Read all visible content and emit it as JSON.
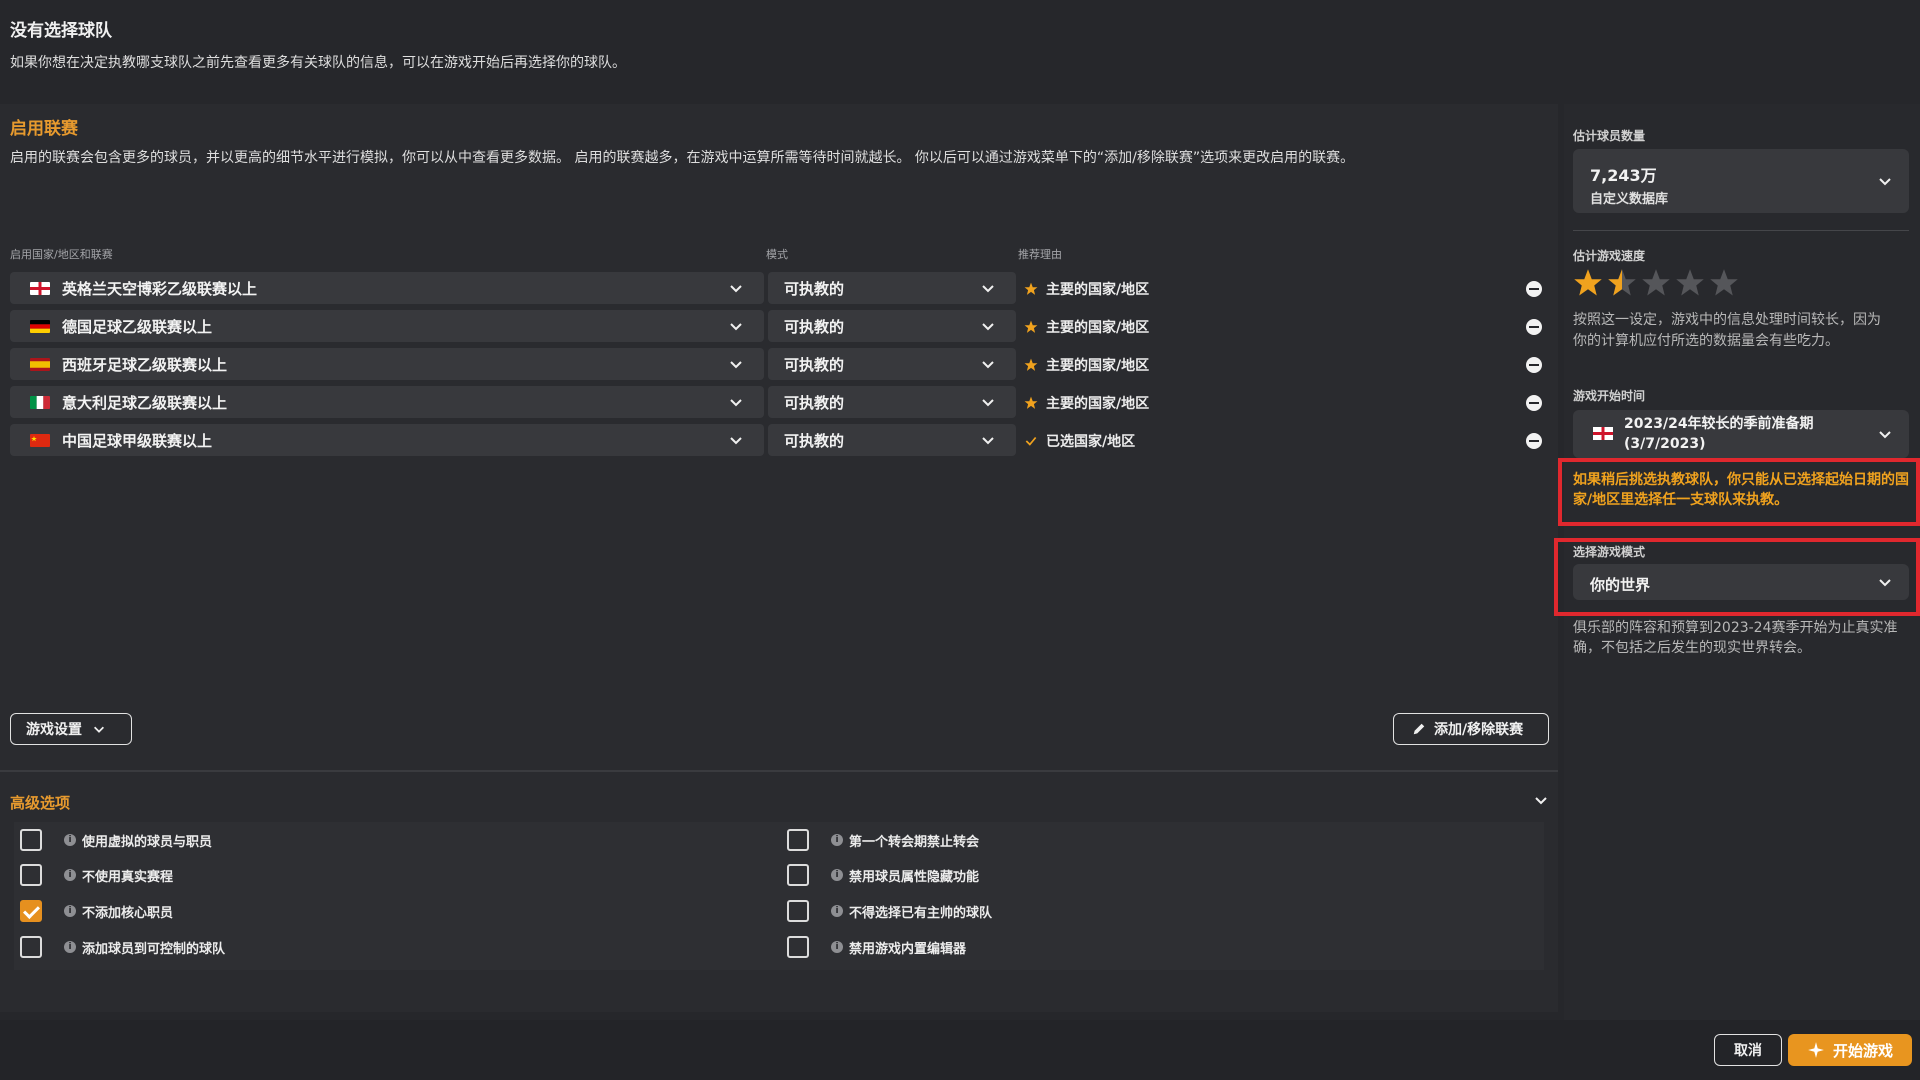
{
  "header": {
    "title": "没有选择球队",
    "description": "如果你想在决定执教哪支球队之前先查看更多有关球队的信息，可以在游戏开始后再选择你的球队。"
  },
  "leagues": {
    "title": "启用联赛",
    "description": "启用的联赛会包含更多的球员，并以更高的细节水平进行模拟，你可以从中查看更多数据。 启用的联赛越多，在游戏中运算所需等待时间就越长。 你以后可以通过游戏菜单下的“添加/移除联赛”选项来更改启用的联赛。",
    "columns": {
      "league": "启用国家/地区和联赛",
      "mode": "模式",
      "reason": "推荐理由"
    },
    "rows": [
      {
        "name": "英格兰天空博彩乙级联赛以上",
        "flag": "england",
        "mode": "可执教的",
        "reason": "主要的国家/地区",
        "reason_icon": "star-icon"
      },
      {
        "name": "德国足球乙级联赛以上",
        "flag": "germany",
        "mode": "可执教的",
        "reason": "主要的国家/地区",
        "reason_icon": "star-icon"
      },
      {
        "name": "西班牙足球乙级联赛以上",
        "flag": "spain",
        "mode": "可执教的",
        "reason": "主要的国家/地区",
        "reason_icon": "star-icon"
      },
      {
        "name": "意大利足球乙级联赛以上",
        "flag": "italy",
        "mode": "可执教的",
        "reason": "主要的国家/地区",
        "reason_icon": "star-icon"
      },
      {
        "name": "中国足球甲级联赛以上",
        "flag": "china",
        "mode": "可执教的",
        "reason": "已选国家/地区",
        "reason_icon": "check-icon"
      }
    ],
    "game_settings_label": "游戏设置",
    "add_remove_label": "添加/移除联赛"
  },
  "advanced": {
    "title": "高级选项",
    "left_options": [
      {
        "label": "使用虚拟的球员与职员",
        "checked": false
      },
      {
        "label": "不使用真实赛程",
        "checked": false
      },
      {
        "label": "不添加核心职员",
        "checked": true
      },
      {
        "label": "添加球员到可控制的球队",
        "checked": false
      }
    ],
    "right_options": [
      {
        "label": "第一个转会期禁止转会",
        "checked": false
      },
      {
        "label": "禁用球员属性隐藏功能",
        "checked": false
      },
      {
        "label": "不得选择已有主帅的球队",
        "checked": false
      },
      {
        "label": "禁用游戏内置编辑器",
        "checked": false
      }
    ]
  },
  "sidebar": {
    "players": {
      "label": "估计球员数量",
      "value": "7,243万",
      "sub": "自定义数据库"
    },
    "speed": {
      "label": "估计游戏速度",
      "rating": 1.5,
      "max": 5,
      "description": "按照这一设定，游戏中的信息处理时间较长，因为你的计算机应付所选的数据量会有些吃力。"
    },
    "start_time": {
      "label": "游戏开始时间",
      "value": "2023/24年较长的季前准备期 (3/7/2023)",
      "warning": "如果稍后挑选执教球队，你只能从已选择起始日期的国家/地区里选择任一支球队来执教。"
    },
    "game_mode": {
      "label": "选择游戏模式",
      "value": "你的世界",
      "description": "俱乐部的阵容和预算到2023-24赛季开始为止真实准确，不包括之后发生的现实世界转会。"
    }
  },
  "footer": {
    "cancel_label": "取消",
    "start_label": "开始游戏"
  },
  "colors": {
    "accent": "#e79a2e",
    "highlight": "#e0282e",
    "warning": "#f0a21e"
  }
}
